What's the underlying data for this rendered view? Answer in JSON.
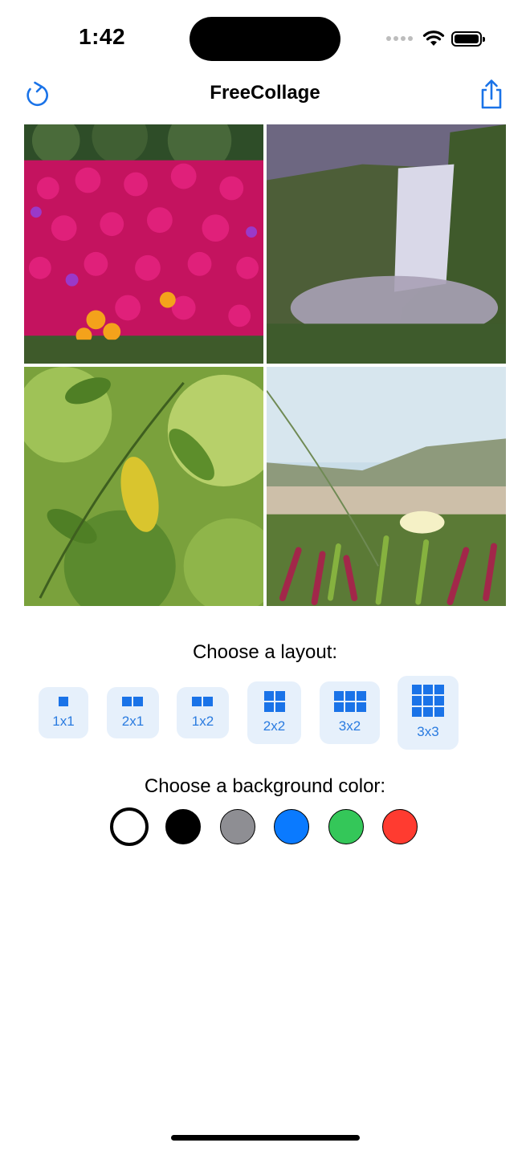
{
  "status": {
    "time": "1:42"
  },
  "nav": {
    "title": "FreeCollage",
    "left_icon": "refresh-icon",
    "right_icon": "share-icon"
  },
  "collage": {
    "photos": [
      {
        "name": "pink-flowers-photo"
      },
      {
        "name": "waterfall-photo"
      },
      {
        "name": "green-leaves-photo"
      },
      {
        "name": "beach-flower-photo"
      }
    ]
  },
  "layout": {
    "title": "Choose a layout:",
    "options": [
      {
        "label": "1x1"
      },
      {
        "label": "2x1"
      },
      {
        "label": "1x2"
      },
      {
        "label": "2x2"
      },
      {
        "label": "3x2"
      },
      {
        "label": "3x3"
      }
    ]
  },
  "colors": {
    "title": "Choose a background color:",
    "options": [
      {
        "name": "white",
        "hex": "#ffffff",
        "selected": true
      },
      {
        "name": "black",
        "hex": "#000000"
      },
      {
        "name": "gray",
        "hex": "#8e8e93"
      },
      {
        "name": "blue",
        "hex": "#0a7aff"
      },
      {
        "name": "green",
        "hex": "#34c759"
      },
      {
        "name": "red",
        "hex": "#ff3b30"
      }
    ]
  }
}
